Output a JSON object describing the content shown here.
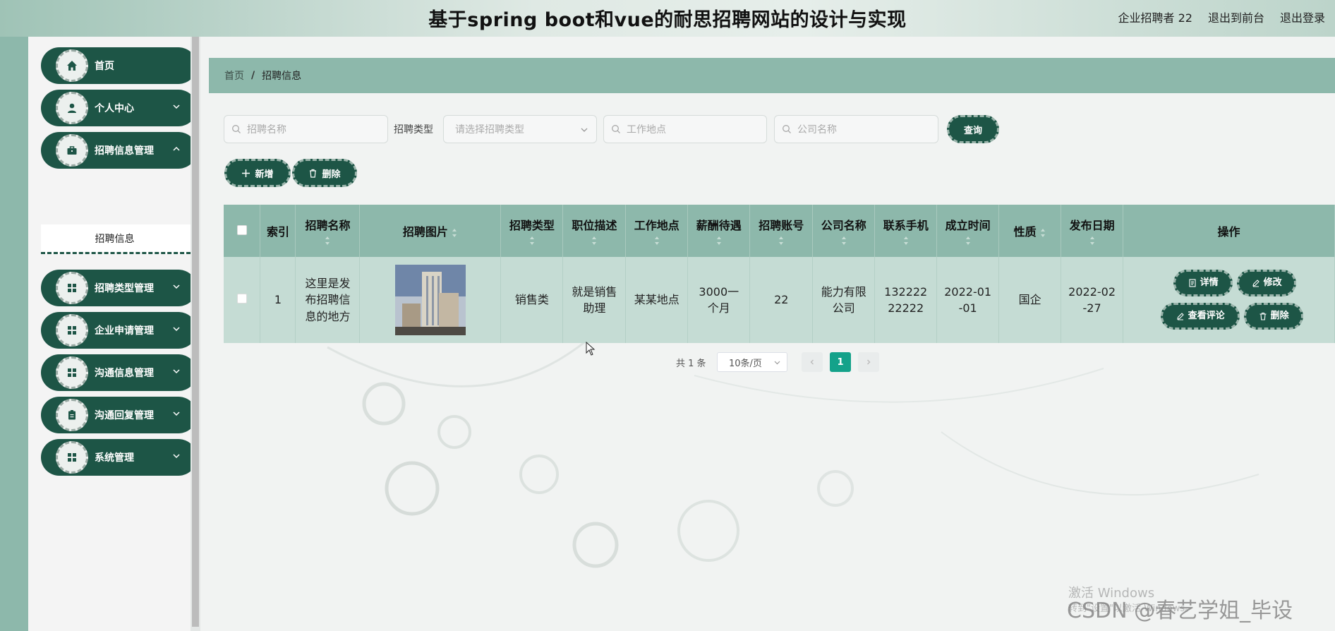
{
  "header": {
    "title": "基于spring boot和vue的耐思招聘网站的设计与实现",
    "user": "企业招聘者 22",
    "to_front": "退出到前台",
    "logout": "退出登录"
  },
  "sidebar": {
    "items": [
      {
        "label": "首页",
        "icon": "home-icon"
      },
      {
        "label": "个人中心",
        "icon": "user-icon"
      },
      {
        "label": "招聘信息管理",
        "icon": "briefcase-icon"
      },
      {
        "label": "招聘类型管理",
        "icon": "grid-icon"
      },
      {
        "label": "企业申请管理",
        "icon": "grid-icon"
      },
      {
        "label": "沟通信息管理",
        "icon": "grid-icon"
      },
      {
        "label": "沟通回复管理",
        "icon": "clipboard-icon"
      },
      {
        "label": "系统管理",
        "icon": "grid-icon"
      }
    ],
    "submenu_label": "招聘信息"
  },
  "breadcrumb": {
    "home": "首页",
    "separator": "/",
    "current": "招聘信息"
  },
  "search": {
    "name_placeholder": "招聘名称",
    "type_label": "招聘类型",
    "type_placeholder": "请选择招聘类型",
    "location_placeholder": "工作地点",
    "company_placeholder": "公司名称",
    "query_label": "查询"
  },
  "actions": {
    "add_label": "新增",
    "delete_label": "删除"
  },
  "table": {
    "columns": [
      "索引",
      "招聘名称",
      "招聘图片",
      "招聘类型",
      "职位描述",
      "工作地点",
      "薪酬待遇",
      "招聘账号",
      "公司名称",
      "联系手机",
      "成立时间",
      "性质",
      "发布日期",
      "操作"
    ],
    "rows": [
      {
        "index": "1",
        "name": "这里是发布招聘信息的地方",
        "type": "销售类",
        "description": "就是销售助理",
        "location": "某某地点",
        "salary": "3000一个月",
        "account": "22",
        "company": "能力有限公司",
        "phone": "13222222222",
        "founded": "2022-01-01",
        "nature": "国企",
        "published": "2022-02-27"
      }
    ],
    "row_actions": {
      "detail": "详情",
      "edit": "修改",
      "comments": "查看评论",
      "delete": "删除"
    }
  },
  "pagination": {
    "total": "共 1 条",
    "page_size": "10条/页",
    "current_page": "1"
  },
  "watermark": {
    "activate": "激活 Windows",
    "hint": "转到\"设置\"以激活 Windows。",
    "csdn": "CSDN @春艺学姐_毕设"
  },
  "colors": {
    "accent": "#1d5546",
    "table_header": "#8db8ab",
    "table_row": "#c5dcd4",
    "page_active": "#14a28a"
  }
}
